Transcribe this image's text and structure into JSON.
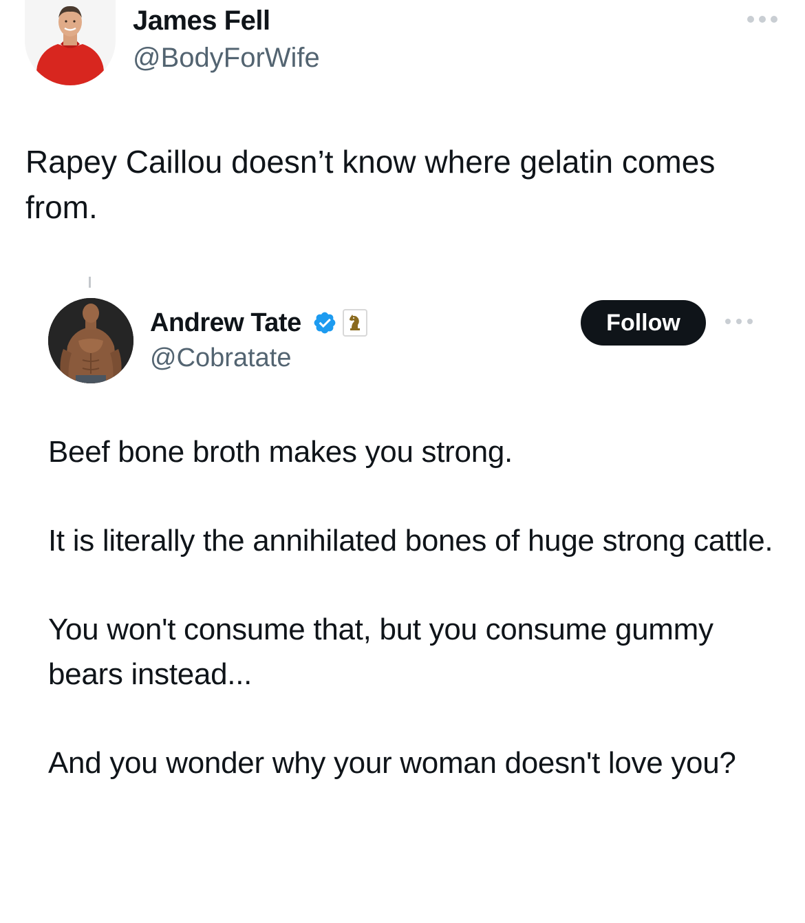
{
  "outer_tweet": {
    "author": {
      "name": "James Fell",
      "handle": "@BodyForWife",
      "avatar_icon": "person-red-shirt-avatar"
    },
    "more_icon": "ellipsis-icon",
    "text": "Rapey Caillou doesn’t know where gelatin comes from."
  },
  "quoted_tweet": {
    "author": {
      "name": "Andrew Tate",
      "handle": "@Cobratate",
      "avatar_icon": "muscular-man-avatar",
      "verified_icon": "verified-badge-icon",
      "affiliate_icon": "chess-knight-badge-icon"
    },
    "follow_label": "Follow",
    "more_icon": "ellipsis-icon",
    "paragraphs": [
      "Beef bone broth makes you strong.",
      "It is literally the annihilated bones of huge strong cattle.",
      "You won't consume that, but you consume gummy bears instead...",
      "And you wonder why your woman doesn't love you?"
    ]
  },
  "colors": {
    "text_primary": "#0f1419",
    "text_secondary": "#536471",
    "verified_blue": "#1d9bf0",
    "follow_button_bg": "#0f1419"
  }
}
